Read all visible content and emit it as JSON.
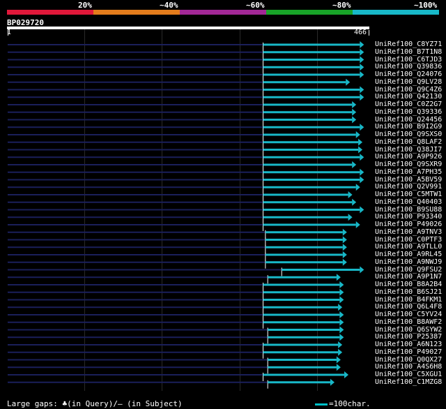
{
  "legend": {
    "percent_labels": [
      "20%",
      "~40%",
      "~60%",
      "~80%",
      "~100%"
    ],
    "colors": [
      "#e0183a",
      "#e37c1c",
      "#a22896",
      "#18a328",
      "#18b8c8"
    ]
  },
  "query": {
    "name": "BP029720",
    "start": "1",
    "end": "466",
    "length": 466
  },
  "hits": [
    {
      "label": "UniRef100_C8YZ71",
      "start": 330,
      "end": 460
    },
    {
      "label": "UniRef100_B7T1N8",
      "start": 330,
      "end": 460
    },
    {
      "label": "UniRef100_C6TJD3",
      "start": 330,
      "end": 460
    },
    {
      "label": "UniRef100_Q39836",
      "start": 330,
      "end": 460
    },
    {
      "label": "UniRef100_Q24076",
      "start": 330,
      "end": 460
    },
    {
      "label": "UniRef100_Q9LV28",
      "start": 330,
      "end": 442
    },
    {
      "label": "UniRef100_Q9C4Z6",
      "start": 330,
      "end": 460
    },
    {
      "label": "UniRef100_Q42130",
      "start": 330,
      "end": 460
    },
    {
      "label": "UniRef100_C0Z2G7",
      "start": 330,
      "end": 450
    },
    {
      "label": "UniRef100_Q39336",
      "start": 330,
      "end": 450
    },
    {
      "label": "UniRef100_Q24456",
      "start": 330,
      "end": 450
    },
    {
      "label": "UniRef100_B9I2G9",
      "start": 330,
      "end": 460
    },
    {
      "label": "UniRef100_Q9SXS0",
      "start": 330,
      "end": 455
    },
    {
      "label": "UniRef100_Q8LAF2",
      "start": 330,
      "end": 458
    },
    {
      "label": "UniRef100_Q38JI7",
      "start": 330,
      "end": 458
    },
    {
      "label": "UniRef100_A9P926",
      "start": 330,
      "end": 460
    },
    {
      "label": "UniRef100_Q9SXR9",
      "start": 330,
      "end": 450
    },
    {
      "label": "UniRef100_A7PH35",
      "start": 330,
      "end": 460
    },
    {
      "label": "UniRef100_A5BV59",
      "start": 330,
      "end": 460
    },
    {
      "label": "UniRef100_Q2V991",
      "start": 330,
      "end": 455
    },
    {
      "label": "UniRef100_C5MTW1",
      "start": 330,
      "end": 445
    },
    {
      "label": "UniRef100_Q40403",
      "start": 330,
      "end": 450
    },
    {
      "label": "UniRef100_B9SU88",
      "start": 330,
      "end": 460
    },
    {
      "label": "UniRef100_P93340",
      "start": 330,
      "end": 445
    },
    {
      "label": "UniRef100_P49026",
      "start": 330,
      "end": 455
    },
    {
      "label": "UniRef100_A9TNV3",
      "start": 333,
      "end": 438
    },
    {
      "label": "UniRef100_C0PTF3",
      "start": 333,
      "end": 438
    },
    {
      "label": "UniRef100_A9TLL0",
      "start": 333,
      "end": 438
    },
    {
      "label": "UniRef100_A9RL45",
      "start": 333,
      "end": 438
    },
    {
      "label": "UniRef100_A9NWJ9",
      "start": 333,
      "end": 438
    },
    {
      "label": "UniRef100_Q9FSU2",
      "start": 354,
      "end": 460
    },
    {
      "label": "UniRef100_A9P1N7",
      "start": 336,
      "end": 430
    },
    {
      "label": "UniRef100_B8A2B4",
      "start": 330,
      "end": 434
    },
    {
      "label": "UniRef100_B6SJ21",
      "start": 330,
      "end": 434
    },
    {
      "label": "UniRef100_B4FKM1",
      "start": 330,
      "end": 434
    },
    {
      "label": "UniRef100_Q6L4F8",
      "start": 330,
      "end": 432
    },
    {
      "label": "UniRef100_C5YV24",
      "start": 330,
      "end": 434
    },
    {
      "label": "UniRef100_B8AWF2",
      "start": 330,
      "end": 434
    },
    {
      "label": "UniRef100_Q6SYW2",
      "start": 336,
      "end": 434
    },
    {
      "label": "UniRef100_P25387",
      "start": 336,
      "end": 434
    },
    {
      "label": "UniRef100_A6N123",
      "start": 330,
      "end": 432
    },
    {
      "label": "UniRef100_P49027",
      "start": 330,
      "end": 432
    },
    {
      "label": "UniRef100_Q0QX27",
      "start": 336,
      "end": 430
    },
    {
      "label": "UniRef100_A4S6H8",
      "start": 336,
      "end": 430
    },
    {
      "label": "UniRef100_C5XGU1",
      "start": 330,
      "end": 440
    },
    {
      "label": "UniRef100_C1MZG8",
      "start": 336,
      "end": 422
    }
  ],
  "footer": {
    "large_gaps_text": "Large gaps: ♣(in Query)/– (in Subject)",
    "scale_text": "=100char."
  }
}
